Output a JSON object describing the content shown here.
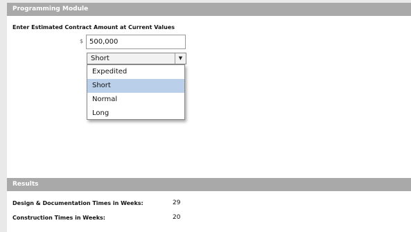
{
  "module": {
    "header": "Programming Module",
    "prompt": "Enter Estimated Contract Amount at Current Values",
    "currency_symbol": "$",
    "amount_value": "500,000",
    "schedule_select": {
      "selected": "Short",
      "options": [
        "Expedited",
        "Short",
        "Normal",
        "Long"
      ]
    }
  },
  "results": {
    "header": "Results",
    "rows": [
      {
        "label": "Design & Documentation Times in Weeks:",
        "value": "29"
      },
      {
        "label": "Construction Times in Weeks:",
        "value": "20"
      }
    ]
  },
  "colors": {
    "header_bg": "#a9a9a9",
    "selected_option_bg": "#b9cfea",
    "page_bg": "#e9e9e9"
  }
}
